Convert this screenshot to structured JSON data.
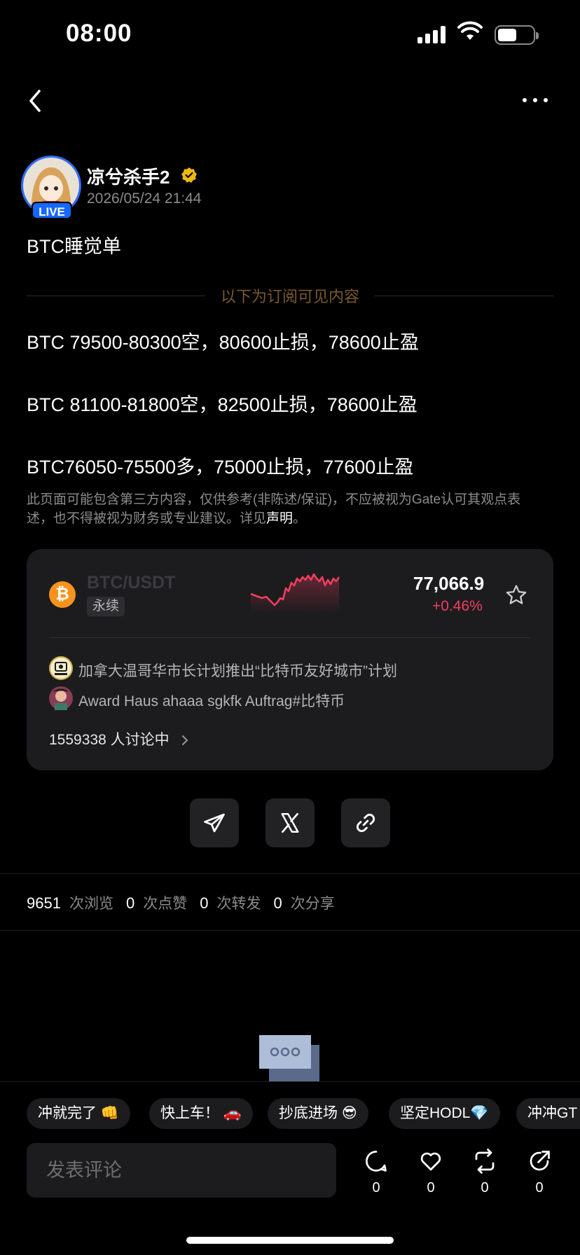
{
  "status_bar": {
    "time": "08:00"
  },
  "post": {
    "author": "凉兮杀手2",
    "live_badge": "LIVE",
    "date": "2026/05/24 21:44",
    "title": "BTC睡觉单",
    "subscribe_divider": "以下为订阅可见内容",
    "lines": [
      "BTC 79500-80300空，80600止损，78600止盈",
      "BTC 81100-81800空，82500止损，78600止盈",
      "BTC76050-75500多，75000止损，77600止盈"
    ],
    "disclaimer": "此页面可能包含第三方内容，仅供参考(非陈述/保证)，不应被视为Gate认可其观点表述，也不得被视为财务或专业建议。详见",
    "disclaimer_link": "声明",
    "disclaimer_end": "。"
  },
  "market_card": {
    "pair": "BTC/USDT",
    "type_tag": "永续",
    "price": "77,066.9",
    "change": "+0.46%",
    "change_color": "#f23d60",
    "news": [
      {
        "text": "加拿大温哥华市长计划推出“比特币友好城市”计划",
        "icon": "coinvoice-avatar"
      },
      {
        "text": "Award Haus ahaaa sgkfk Auftrag#比特币",
        "icon": "user-avatar"
      }
    ],
    "discussion": "1559338 人讨论中"
  },
  "share": {
    "icons": [
      "telegram-icon",
      "x-icon",
      "link-icon"
    ]
  },
  "stats": [
    {
      "count": "9651",
      "label": "次浏览"
    },
    {
      "count": "0",
      "label": "次点赞"
    },
    {
      "count": "0",
      "label": "次转发"
    },
    {
      "count": "0",
      "label": "次分享"
    }
  ],
  "quick_replies": [
    "冲就完了 👊",
    "快上车！ 🚗",
    "抄底进场 😎",
    "坚定HODL💎",
    "冲冲GT"
  ],
  "comment": {
    "placeholder": "发表评论"
  },
  "actions": [
    {
      "icon": "comment-icon",
      "count": "0"
    },
    {
      "icon": "like-icon",
      "count": "0"
    },
    {
      "icon": "repost-icon",
      "count": "0"
    },
    {
      "icon": "share-icon",
      "count": "0"
    }
  ],
  "colors": {
    "accent_gold": "#7a5a2c",
    "live_blue": "#1668ff",
    "btc_orange": "#f7931a"
  }
}
